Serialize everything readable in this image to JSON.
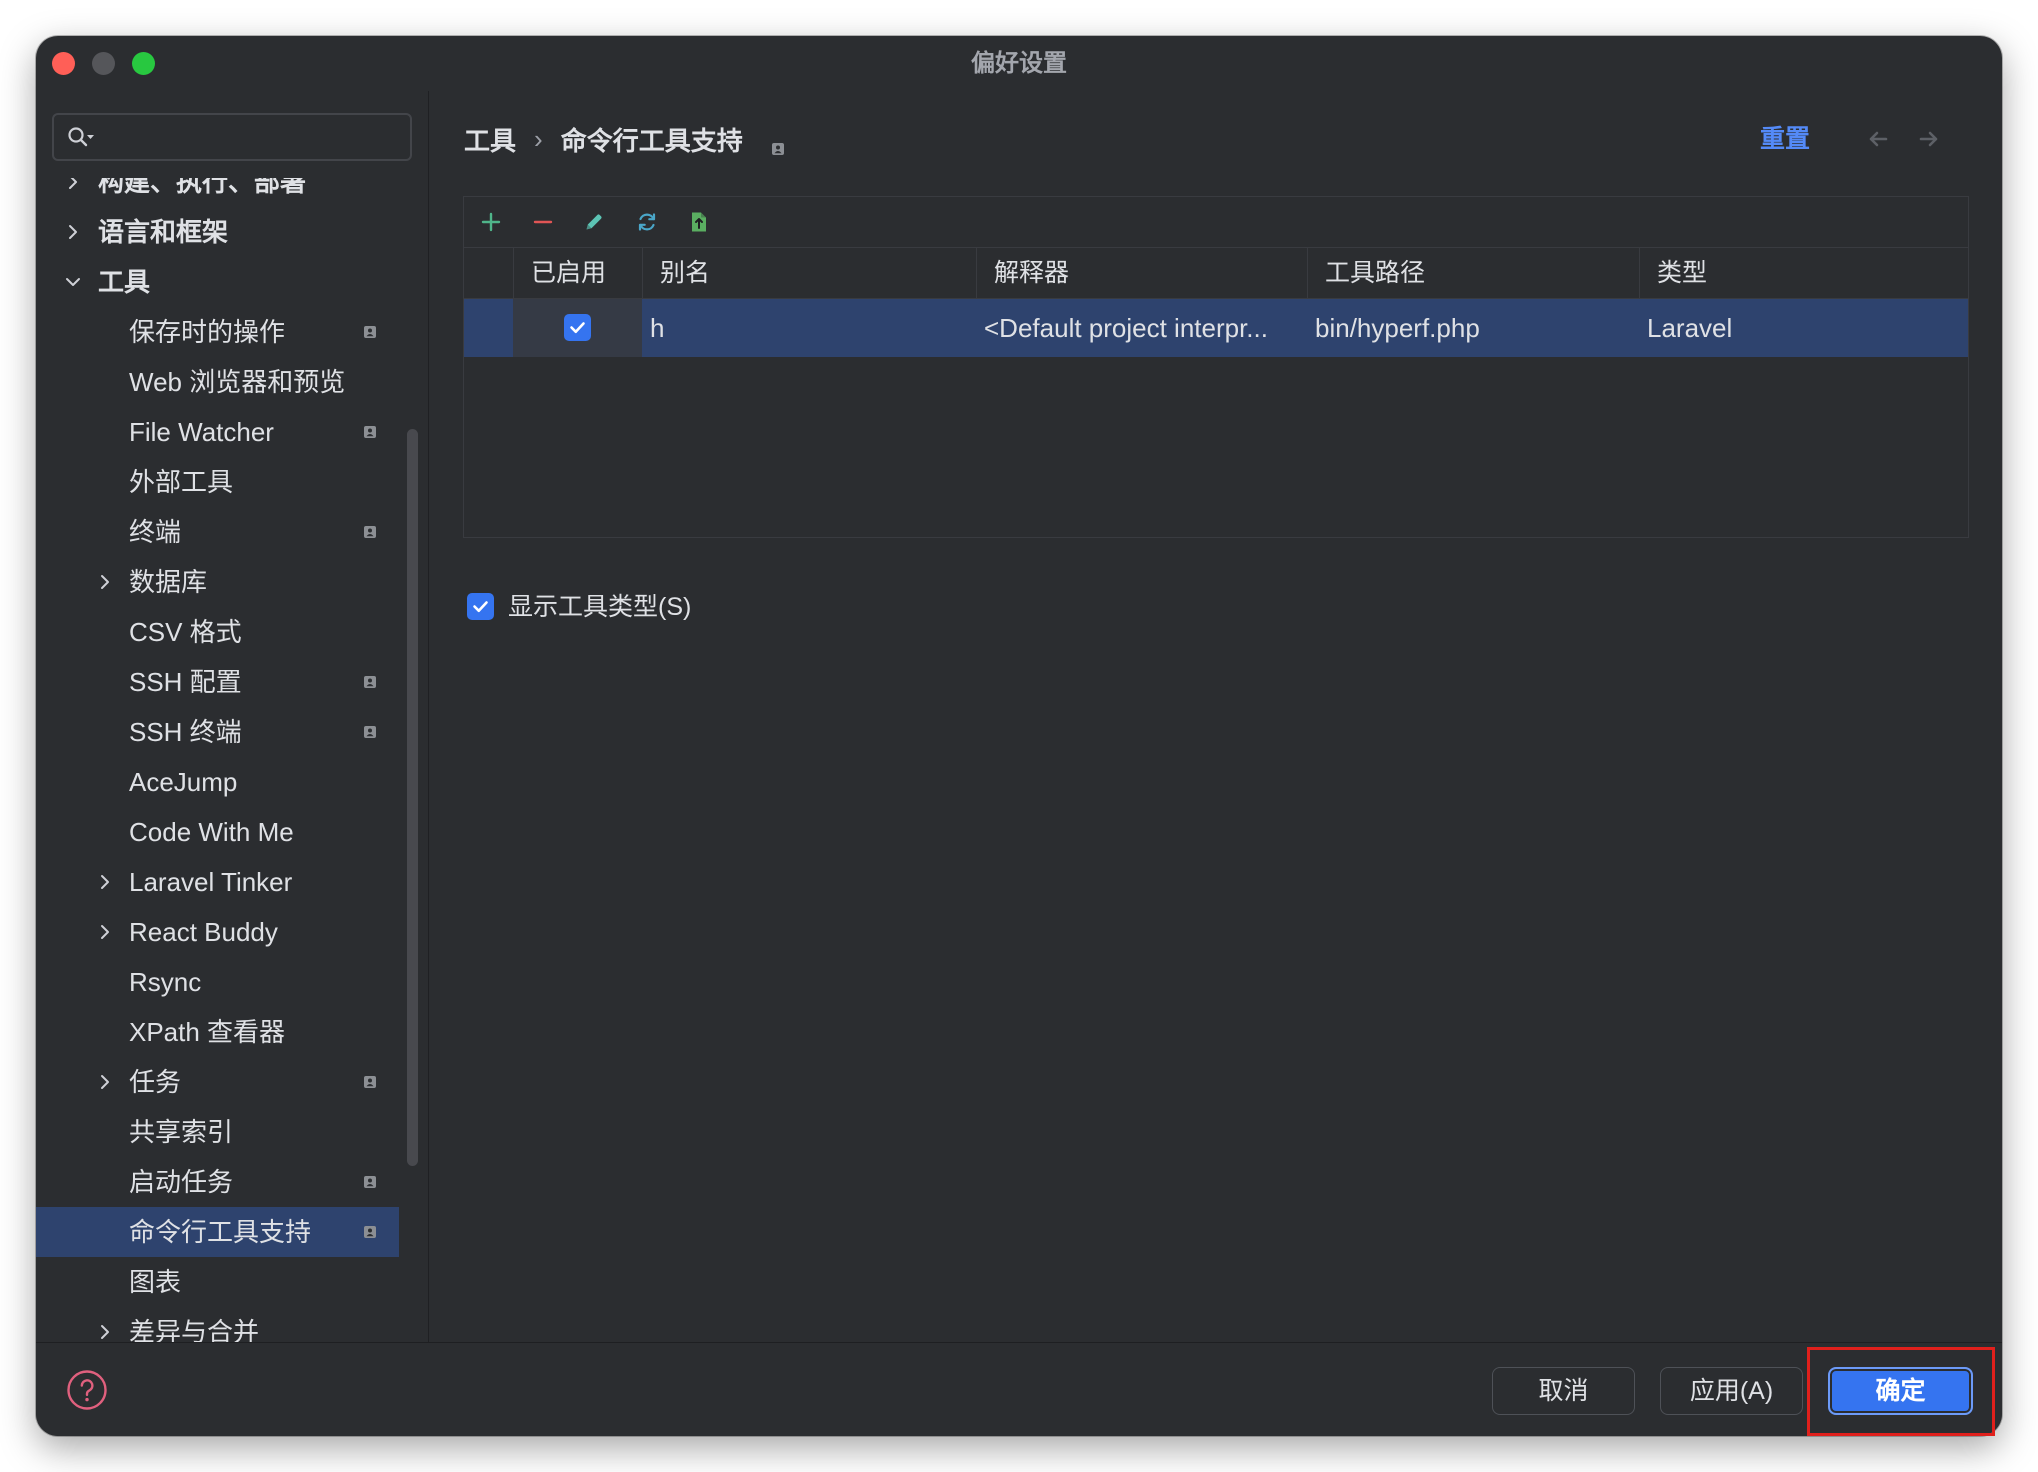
{
  "window": {
    "title": "偏好设置"
  },
  "search": {
    "placeholder": "",
    "value": "",
    "icon": "search-icon"
  },
  "sidebar": {
    "tree": [
      {
        "label": "构建、执行、部署",
        "has_children": true,
        "expanded": false
      },
      {
        "label": "语言和框架",
        "has_children": true,
        "expanded": false
      },
      {
        "label": "工具",
        "has_children": true,
        "expanded": true,
        "children": [
          {
            "label": "保存时的操作",
            "project_level": true
          },
          {
            "label": "Web 浏览器和预览"
          },
          {
            "label": "File Watcher",
            "project_level": true
          },
          {
            "label": "外部工具"
          },
          {
            "label": "终端",
            "project_level": true
          },
          {
            "label": "数据库",
            "has_children": true,
            "expanded": false
          },
          {
            "label": "CSV 格式"
          },
          {
            "label": "SSH 配置",
            "project_level": true
          },
          {
            "label": "SSH 终端",
            "project_level": true
          },
          {
            "label": "AceJump"
          },
          {
            "label": "Code With Me"
          },
          {
            "label": "Laravel Tinker",
            "has_children": true,
            "expanded": false
          },
          {
            "label": "React Buddy",
            "has_children": true,
            "expanded": false
          },
          {
            "label": "Rsync"
          },
          {
            "label": "XPath 查看器"
          },
          {
            "label": "任务",
            "has_children": true,
            "expanded": false,
            "project_level": true
          },
          {
            "label": "共享索引"
          },
          {
            "label": "启动任务",
            "project_level": true
          },
          {
            "label": "命令行工具支持",
            "project_level": true,
            "selected": true
          },
          {
            "label": "图表"
          },
          {
            "label": "差异与合并",
            "has_children": true,
            "expanded": false
          }
        ]
      }
    ]
  },
  "header": {
    "breadcrumb": {
      "parent": "工具",
      "separator": "›",
      "current": "命令行工具支持",
      "current_icon": "project-level-icon"
    },
    "reset": "重置",
    "nav": {
      "back_icon": "back-arrow-icon",
      "forward_icon": "forward-arrow-icon",
      "back_enabled": false,
      "forward_enabled": false
    }
  },
  "table": {
    "toolbar": [
      "add-icon",
      "remove-icon",
      "edit-icon",
      "refresh-icon",
      "import-icon"
    ],
    "columns": [
      "已启用",
      "别名",
      "解释器",
      "工具路径",
      "类型"
    ],
    "rows": [
      {
        "enabled": true,
        "alias": "h",
        "interpreter": "<Default project interpr...",
        "path": "bin/hyperf.php",
        "type": "Laravel",
        "selected": true
      }
    ]
  },
  "options": {
    "show_tool_type": {
      "label": "显示工具类型(S)",
      "checked": true
    }
  },
  "footer": {
    "help_icon": "help-icon",
    "cancel": "取消",
    "apply": "应用(A)",
    "ok": "确定"
  },
  "colors": {
    "accent": "#3574f0",
    "selection": "#2e436e",
    "link": "#548af7",
    "add": "#4fb58a",
    "remove": "#e05555",
    "edit": "#5cc4b4",
    "refresh": "#4aa6c8",
    "import": "#5aae61",
    "help": "#e0607e",
    "annotation": "#e0201c",
    "close": "#ff5f57",
    "minimize": "#55565a",
    "zoom": "#28c840"
  }
}
